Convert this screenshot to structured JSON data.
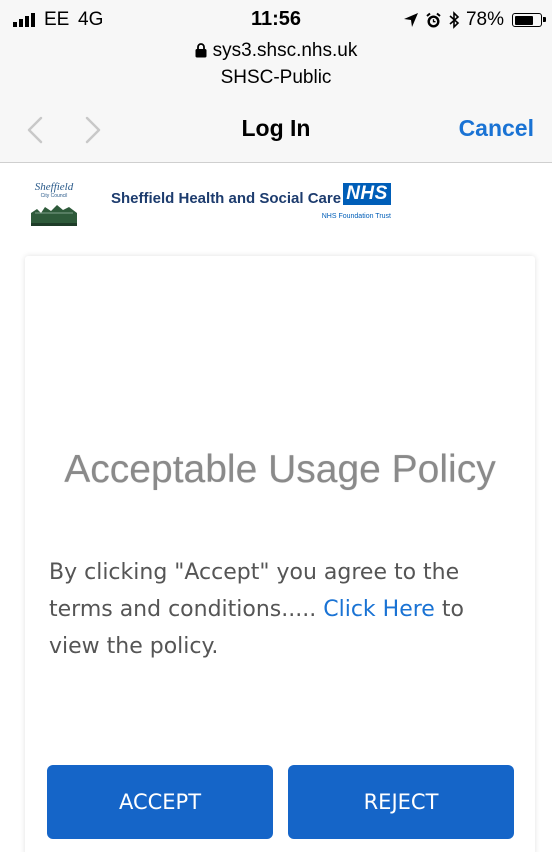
{
  "status_bar": {
    "carrier": "EE",
    "network": "4G",
    "time": "11:56",
    "battery_percent": "78%",
    "battery_level": 0.78,
    "icons": [
      "signal-bars-icon",
      "location-arrow-icon",
      "alarm-clock-icon",
      "bluetooth-icon",
      "battery-icon"
    ]
  },
  "browser": {
    "url": "sys3.shsc.nhs.uk",
    "site_name": "SHSC-Public"
  },
  "nav": {
    "title": "Log In",
    "cancel_label": "Cancel"
  },
  "header": {
    "council_name": "Sheffield",
    "council_sub": "City Council",
    "trust_name": "Sheffield Health and Social Care",
    "nhs_logo": "NHS",
    "nhs_sub": "NHS Foundation Trust"
  },
  "policy": {
    "title": "Acceptable Usage Policy",
    "body_before_link": "By clicking \"Accept\" you agree to the terms and conditions..... ",
    "link_text": "Click Here",
    "body_after_link": " to view the policy."
  },
  "buttons": {
    "accept_label": "ACCEPT",
    "reject_label": "REJECT"
  },
  "colors": {
    "accent": "#1a73d4",
    "button": "#1565c8",
    "nhs_blue": "#005eb8"
  }
}
